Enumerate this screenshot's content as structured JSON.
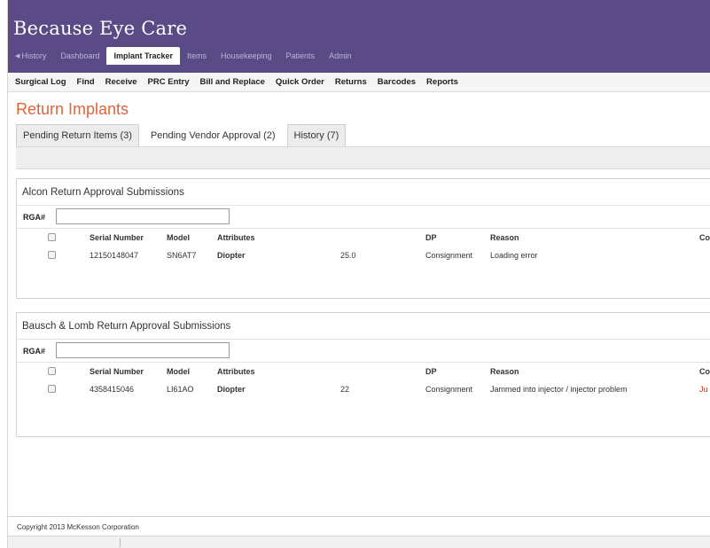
{
  "app": {
    "title": "Because Eye Care"
  },
  "nav": {
    "items": [
      {
        "label": "History",
        "icon": "left-arrow-icon"
      },
      {
        "label": "Dashboard"
      },
      {
        "label": "Implant Tracker",
        "active": true
      },
      {
        "label": "Items"
      },
      {
        "label": "Housekeeping"
      },
      {
        "label": "Patients"
      },
      {
        "label": "Admin"
      }
    ]
  },
  "subnav": {
    "items": [
      "Surgical Log",
      "Find",
      "Receive",
      "PRC Entry",
      "Bill and Replace",
      "Quick Order",
      "Returns",
      "Barcodes",
      "Reports"
    ]
  },
  "page": {
    "title": "Return Implants"
  },
  "tabs": [
    {
      "label": "Pending Return Items (3)"
    },
    {
      "label": "Pending Vendor Approval (2)",
      "active": true
    },
    {
      "label": "History (7)"
    }
  ],
  "columns": {
    "serial": "Serial Number",
    "model": "Model",
    "attributes": "Attributes",
    "dp": "DP",
    "reason": "Reason",
    "co": "Co"
  },
  "panels": [
    {
      "title": "Alcon Return Approval Submissions",
      "rga_label": "RGA#",
      "rga_value": "",
      "rows": [
        {
          "serial": "12150148047",
          "model": "SN6AT7",
          "attr_name": "Diopter",
          "attr_value": "25.0",
          "dp": "Consignment",
          "reason": "Loading error",
          "co": ""
        }
      ]
    },
    {
      "title": "Bausch & Lomb Return Approval Submissions",
      "rga_label": "RGA#",
      "rga_value": "",
      "rows": [
        {
          "serial": "4358415046",
          "model": "LI61AO",
          "attr_name": "Diopter",
          "attr_value": "22",
          "dp": "Consignment",
          "reason": "Jammed into injector / injector problem",
          "co": "Ju"
        }
      ]
    }
  ],
  "footer": {
    "copyright": "Copyright 2013 McKesson Corporation"
  },
  "colors": {
    "header": "#5a4a86",
    "title_accent": "#e2623a",
    "co_text": "#c83b1e"
  }
}
